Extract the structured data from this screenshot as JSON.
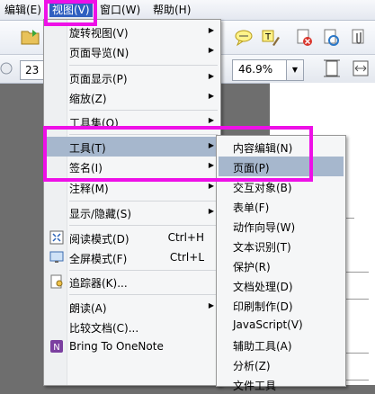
{
  "menubar": {
    "edit": "编辑(E)",
    "view": "视图(V)",
    "window": "窗口(W)",
    "help": "帮助(H)"
  },
  "toolbar": {
    "page_number": "23",
    "zoom": "46.9%"
  },
  "view_menu": {
    "items": [
      {
        "label": "旋转视图(V)",
        "submenu": true
      },
      {
        "label": "页面导览(N)",
        "submenu": true
      },
      {
        "label": "页面显示(P)",
        "submenu": true
      },
      {
        "label": "缩放(Z)",
        "submenu": true
      },
      {
        "label": "工具集(O)",
        "submenu": true
      },
      {
        "label": "工具(T)",
        "submenu": true
      },
      {
        "label": "签名(I)",
        "submenu": true
      },
      {
        "label": "注释(M)",
        "submenu": true
      },
      {
        "label": "显示/隐藏(S)",
        "submenu": true
      },
      {
        "label": "阅读模式(D)",
        "shortcut": "Ctrl+H",
        "icon": "read-mode-icon"
      },
      {
        "label": "全屏模式(F)",
        "shortcut": "Ctrl+L",
        "icon": "fullscreen-icon"
      },
      {
        "label": "追踪器(K)...",
        "icon": "tracker-icon"
      },
      {
        "label": "朗读(A)",
        "submenu": true
      },
      {
        "label": "比较文档(C)..."
      },
      {
        "label": "Bring To OneNote",
        "icon": "onenote-icon"
      }
    ]
  },
  "tools_menu": {
    "items": [
      {
        "label": "内容编辑(N)"
      },
      {
        "label": "页面(P)"
      },
      {
        "label": "交互对象(B)"
      },
      {
        "label": "表单(F)"
      },
      {
        "label": "动作向导(W)"
      },
      {
        "label": "文本识别(T)"
      },
      {
        "label": "保护(R)"
      },
      {
        "label": "文档处理(D)"
      },
      {
        "label": "印刷制作(D)"
      },
      {
        "label": "JavaScript(V)"
      },
      {
        "label": "辅助工具(A)"
      },
      {
        "label": "分析(Z)"
      },
      {
        "label": "文件工具"
      }
    ]
  },
  "colors": {
    "highlight_box": "#ee10e7",
    "menu_hover": "#a6b7cd",
    "menubar_active": "#2f5fc0"
  }
}
